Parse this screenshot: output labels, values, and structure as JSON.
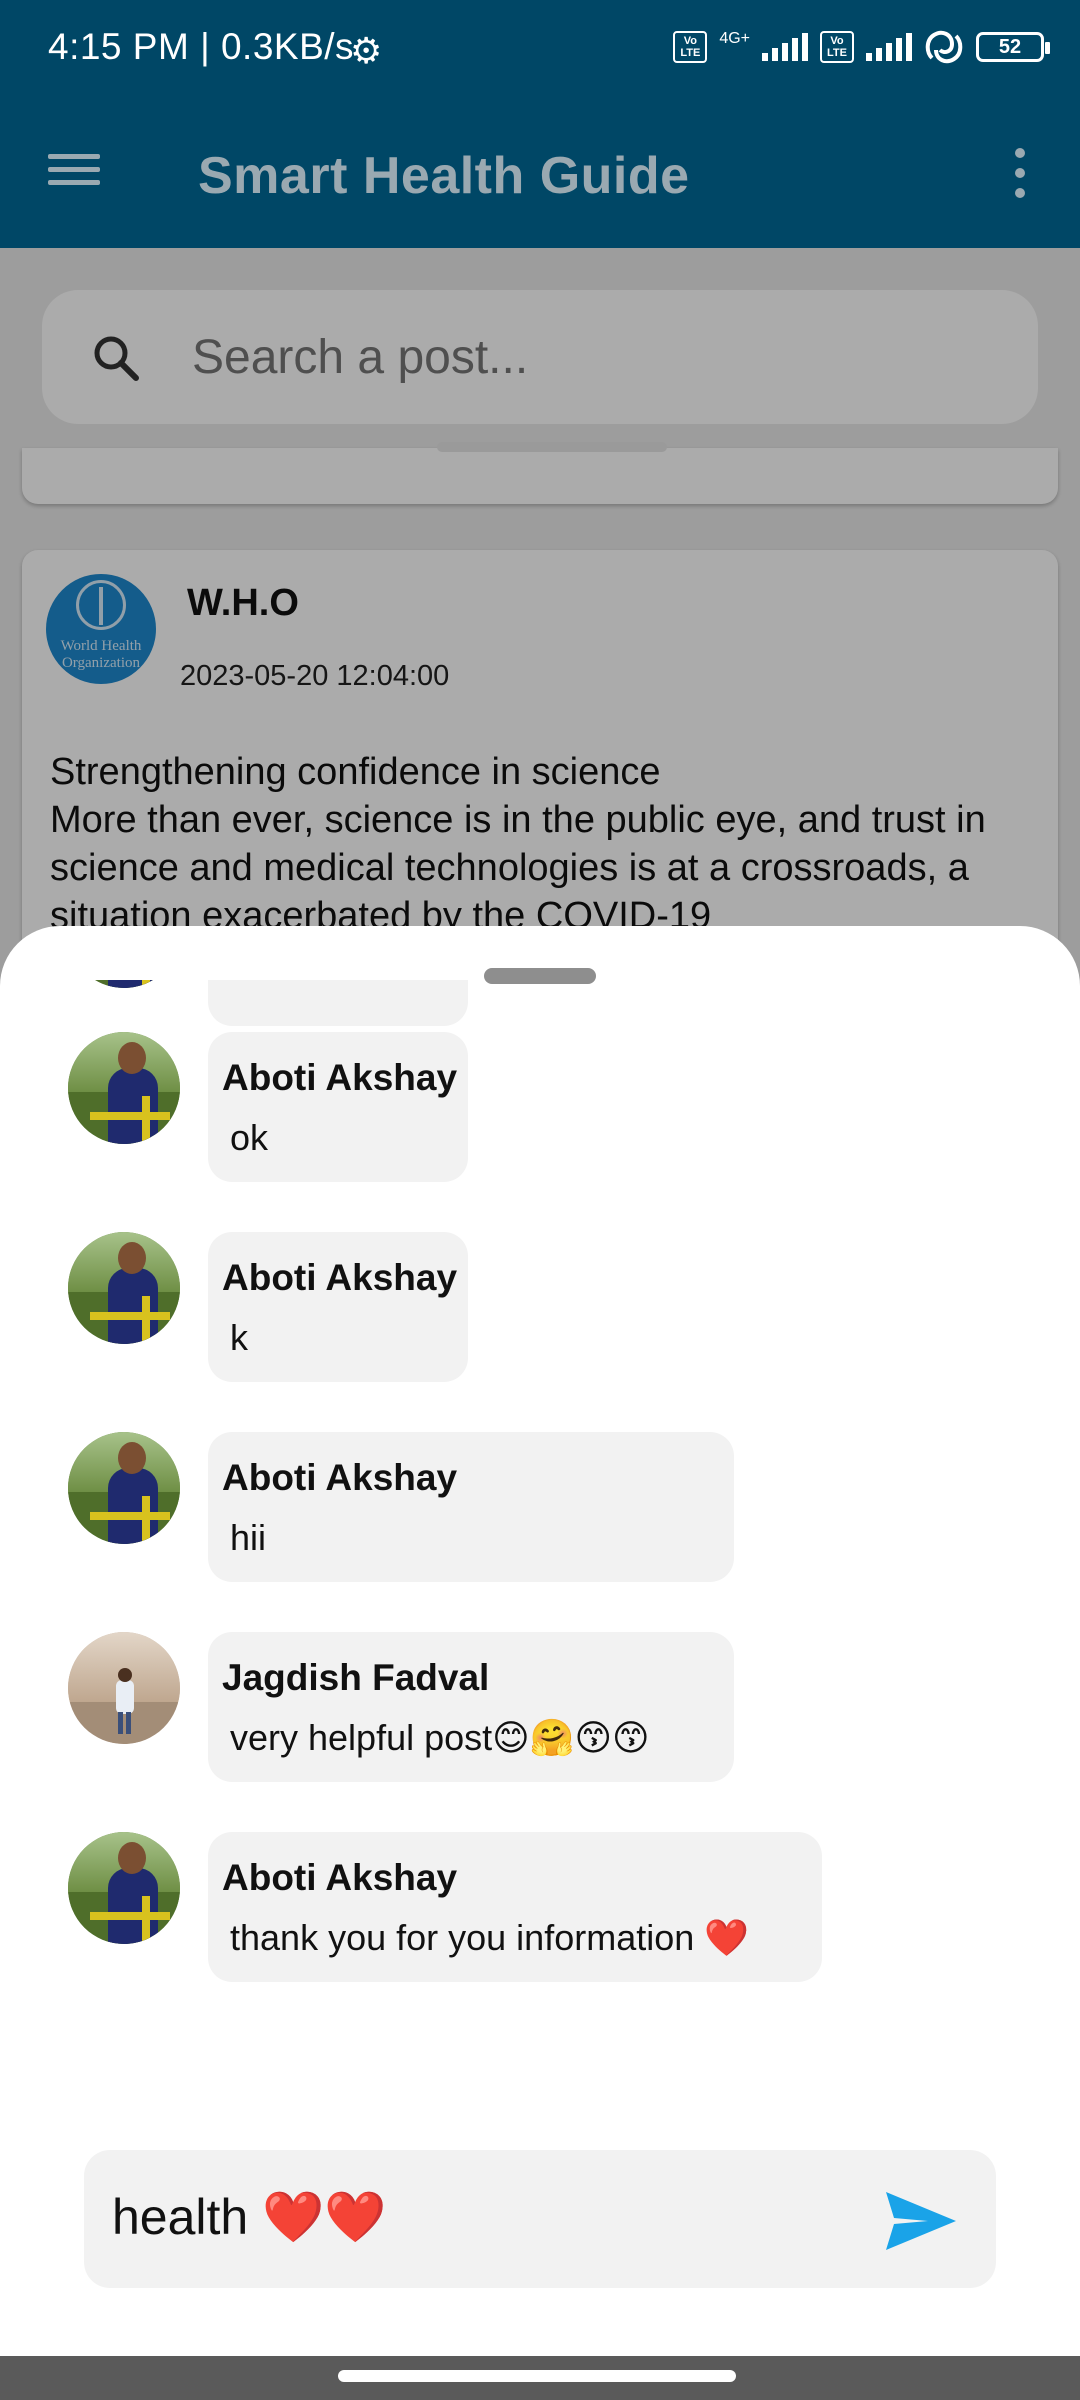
{
  "status_bar": {
    "time": "4:15 PM | 0.3KB/s",
    "lte1": "Vo LTE",
    "network": "4G+",
    "lte2": "Vo LTE",
    "battery": "52"
  },
  "app_bar": {
    "title": "Smart Health Guide"
  },
  "search": {
    "placeholder": "Search a post..."
  },
  "post": {
    "author": "W.H.O",
    "avatar_text": "World Health Organization",
    "date": "2023-05-20 12:04:00",
    "body_line1": "Strengthening confidence in science",
    "body_line2": "More than ever, science is in the public eye, and trust in science and medical technologies is at a crossroads, a situation exacerbated by the COVID-19"
  },
  "comments": [
    {
      "name": "",
      "text": "hii",
      "avatar": "akshay"
    },
    {
      "name": "Aboti Akshay",
      "text": "ok",
      "avatar": "akshay"
    },
    {
      "name": "Aboti Akshay",
      "text": "k",
      "avatar": "akshay"
    },
    {
      "name": "Aboti Akshay",
      "text": "hii",
      "avatar": "akshay"
    },
    {
      "name": "Jagdish Fadval",
      "text": "very helpful post😊🤗😙😙",
      "avatar": "jagdish"
    },
    {
      "name": "Aboti Akshay",
      "text": "thank you for you information ❤️",
      "avatar": "akshay"
    }
  ],
  "composer": {
    "value": "health ❤️❤️",
    "send_icon": "send-icon"
  },
  "colors": {
    "app_bar": "#004766",
    "send": "#1aa3e8",
    "bubble": "#f2f2f2"
  }
}
